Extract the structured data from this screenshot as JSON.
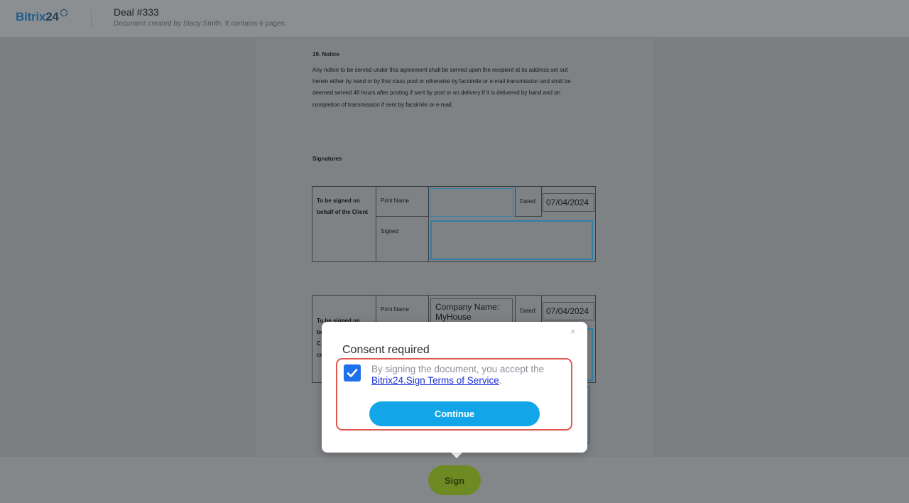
{
  "header": {
    "logo_text": "Bitrix",
    "logo_number": "24",
    "title": "Deal #333",
    "subtitle": "Document created by Stacy Smith. It contains 6 pages."
  },
  "document": {
    "notice_heading": "19. Notice",
    "notice_body": "Any notice to be served under this agreement shall be served upon the recipient at its address set out herein either by hand or by first class post or otherwise by facsimile or e-mail transmission and shall be deemed served 48 hours after posting if sent by post or on delivery if it is delivered by hand and on completion of transmission if sent by facsimile or e-mail.",
    "signatures_heading": "Signatures",
    "client_block": {
      "party_label": "To be signed on behalf of the Client",
      "print_name_label": "Print Name",
      "signed_label": "Signed",
      "dated_label": "Dated:",
      "date_value": "07/04/2024",
      "print_name_value": ""
    },
    "company_block": {
      "party_label": "To be signed on",
      "party_label_rest": [
        "be",
        "C",
        "co"
      ],
      "print_name_label": "Print Name",
      "company_value": "Company Name: MyHouse",
      "dated_label": "Dated:",
      "date_value": "07/04/2024"
    }
  },
  "modal": {
    "close_label": "×",
    "title": "Consent required",
    "checkbox_checked": true,
    "consent_prefix": "By signing the document, you accept the",
    "terms_link": "Bitrix24.Sign Terms of Service",
    "consent_suffix": ".",
    "continue_label": "Continue"
  },
  "footer": {
    "sign_label": "Sign"
  },
  "colors": {
    "accent_blue": "#12a6e8",
    "checkbox_blue": "#1f70ec",
    "highlight_red": "#e0584f",
    "sign_green": "#6e8a22"
  }
}
